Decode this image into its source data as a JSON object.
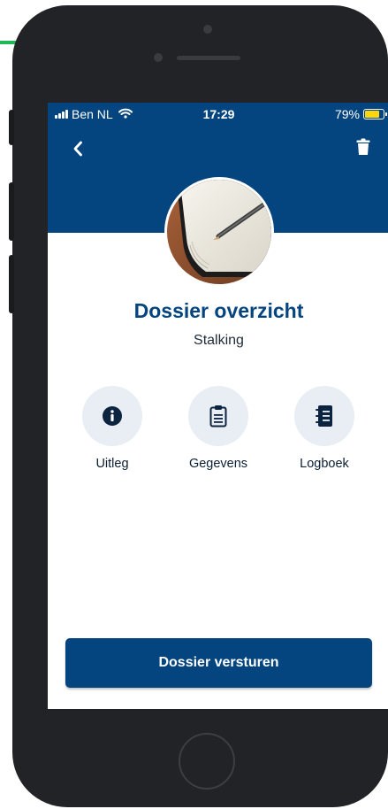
{
  "status_bar": {
    "carrier": "Ben NL",
    "time": "17:29",
    "battery": "79%",
    "battery_level": 0.79
  },
  "header": {
    "back_icon": "chevron-left-icon",
    "delete_icon": "trash-icon"
  },
  "dossier": {
    "title": "Dossier overzicht",
    "subtitle": "Stalking"
  },
  "actions": [
    {
      "label": "Uitleg",
      "icon": "info-icon"
    },
    {
      "label": "Gegevens",
      "icon": "clipboard-icon"
    },
    {
      "label": "Logboek",
      "icon": "notebook-icon"
    }
  ],
  "send_button": {
    "label": "Dossier versturen"
  },
  "colors": {
    "primary": "#04447f",
    "icon_circle": "#e8eef3",
    "battery": "#ffd60a",
    "accent_line": "#1db954"
  }
}
